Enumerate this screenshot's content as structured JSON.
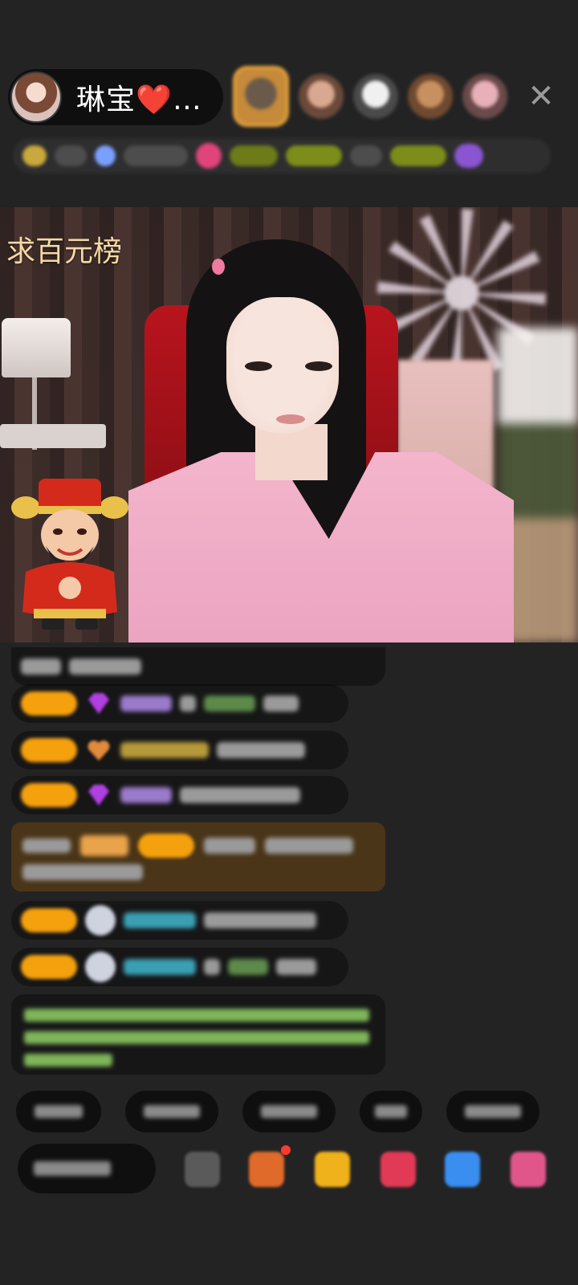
{
  "header": {
    "host_name": "琳宝❤️…",
    "close_symbol": "✕"
  },
  "video": {
    "caption": "求百元榜"
  },
  "colors": {
    "background": "#232324",
    "caption": "#f6d9a6",
    "badge": "#f5a10e",
    "highlight_bg": "#4a3518"
  },
  "icons": [
    "user-avatar-icon",
    "close-icon",
    "fortune-god-sticker-icon",
    "diamond-icon",
    "gift-icon",
    "heart-icon",
    "controller-icon"
  ]
}
